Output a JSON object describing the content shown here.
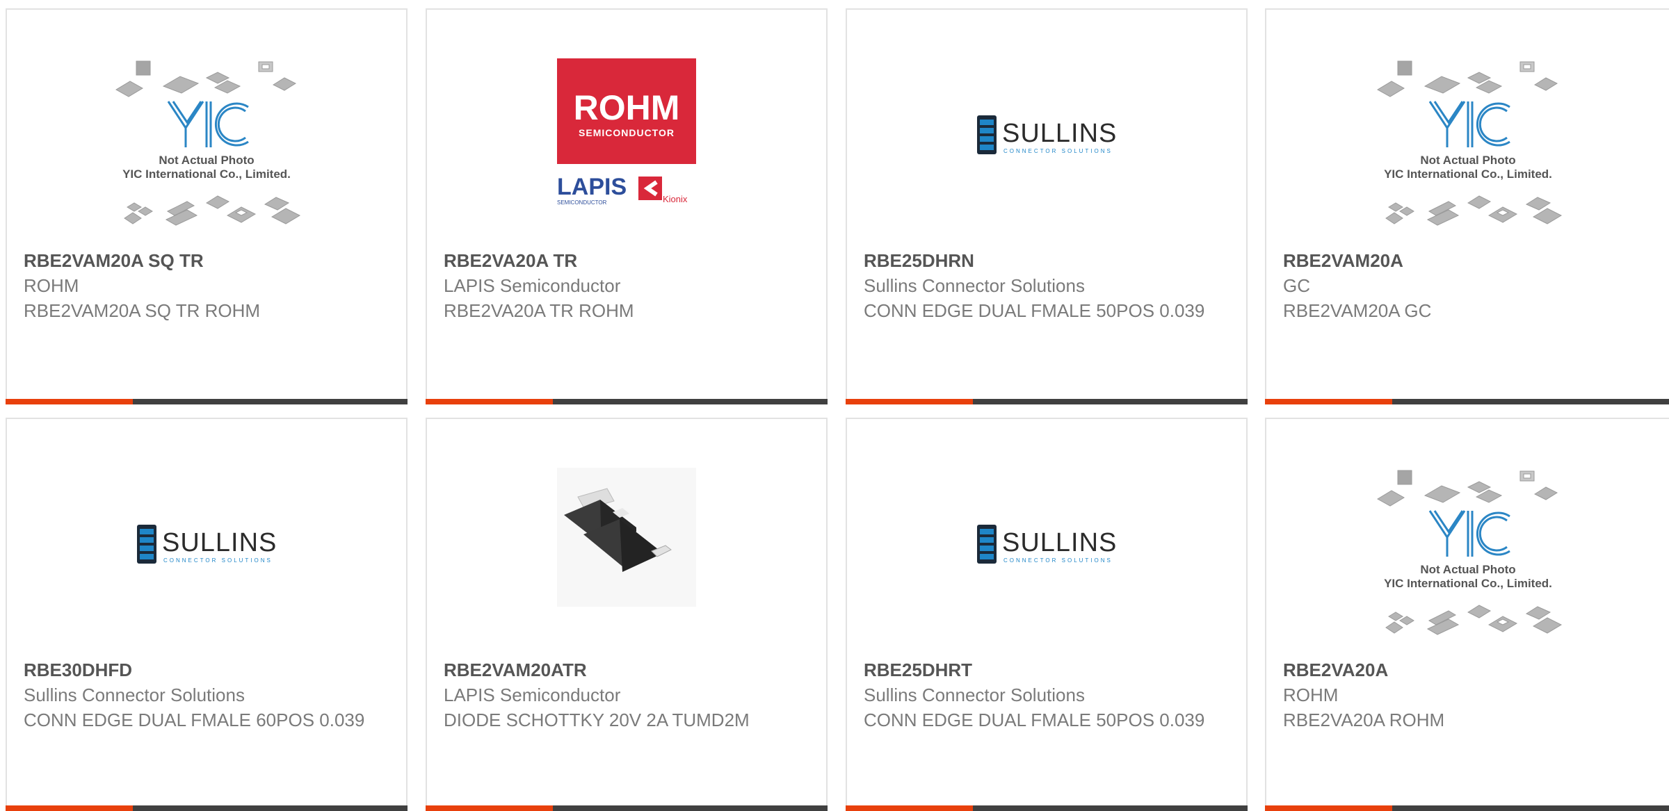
{
  "colors": {
    "accent": "#e8400c",
    "bar_dark": "#404040",
    "border": "#e2e2e2",
    "title_text": "#555555",
    "body_text": "#7a7a7a",
    "rohm_red": "#d9283a",
    "lapis_blue": "#2d4e9b",
    "sullins_blue": "#1f86c8",
    "yic_blue": "#2b86c5"
  },
  "images": {
    "yic_placeholder": {
      "line1": "Not Actual Photo",
      "line2": "YIC International Co., Limited.",
      "logo": "YIC"
    },
    "rohm_logo": {
      "brand": "ROHM",
      "sub": "SEMICONDUCTOR",
      "lapis": "LAPIS",
      "lapis_sub": "SEMICONDUCTOR",
      "kionix": "Kionix"
    },
    "sullins_logo": {
      "brand": "SULLINS",
      "sub": "CONNECTOR SOLUTIONS"
    }
  },
  "products": [
    {
      "part_number": "RBE2VAM20A SQ TR",
      "manufacturer": "ROHM",
      "description": "RBE2VAM20A SQ TR ROHM",
      "image": "yic-placeholder-icon"
    },
    {
      "part_number": "RBE2VA20A TR",
      "manufacturer": "LAPIS Semiconductor",
      "description": "RBE2VA20A TR ROHM",
      "image": "rohm-lapis-logo"
    },
    {
      "part_number": "RBE25DHRN",
      "manufacturer": "Sullins Connector Solutions",
      "description": "CONN EDGE DUAL FMALE 50POS 0.039",
      "image": "sullins-logo"
    },
    {
      "part_number": "RBE2VAM20A",
      "manufacturer": "GC",
      "description": "RBE2VAM20A GC",
      "image": "yic-placeholder-icon"
    },
    {
      "part_number": "RBE30DHFD",
      "manufacturer": "Sullins Connector Solutions",
      "description": "CONN EDGE DUAL FMALE 60POS 0.039",
      "image": "sullins-logo"
    },
    {
      "part_number": "RBE2VAM20ATR",
      "manufacturer": "LAPIS Semiconductor",
      "description": "DIODE SCHOTTKY 20V 2A TUMD2M",
      "image": "smd-diode-photo"
    },
    {
      "part_number": "RBE25DHRT",
      "manufacturer": "Sullins Connector Solutions",
      "description": "CONN EDGE DUAL FMALE 50POS 0.039",
      "image": "sullins-logo"
    },
    {
      "part_number": "RBE2VA20A",
      "manufacturer": "ROHM",
      "description": "RBE2VA20A ROHM",
      "image": "yic-placeholder-icon"
    }
  ]
}
